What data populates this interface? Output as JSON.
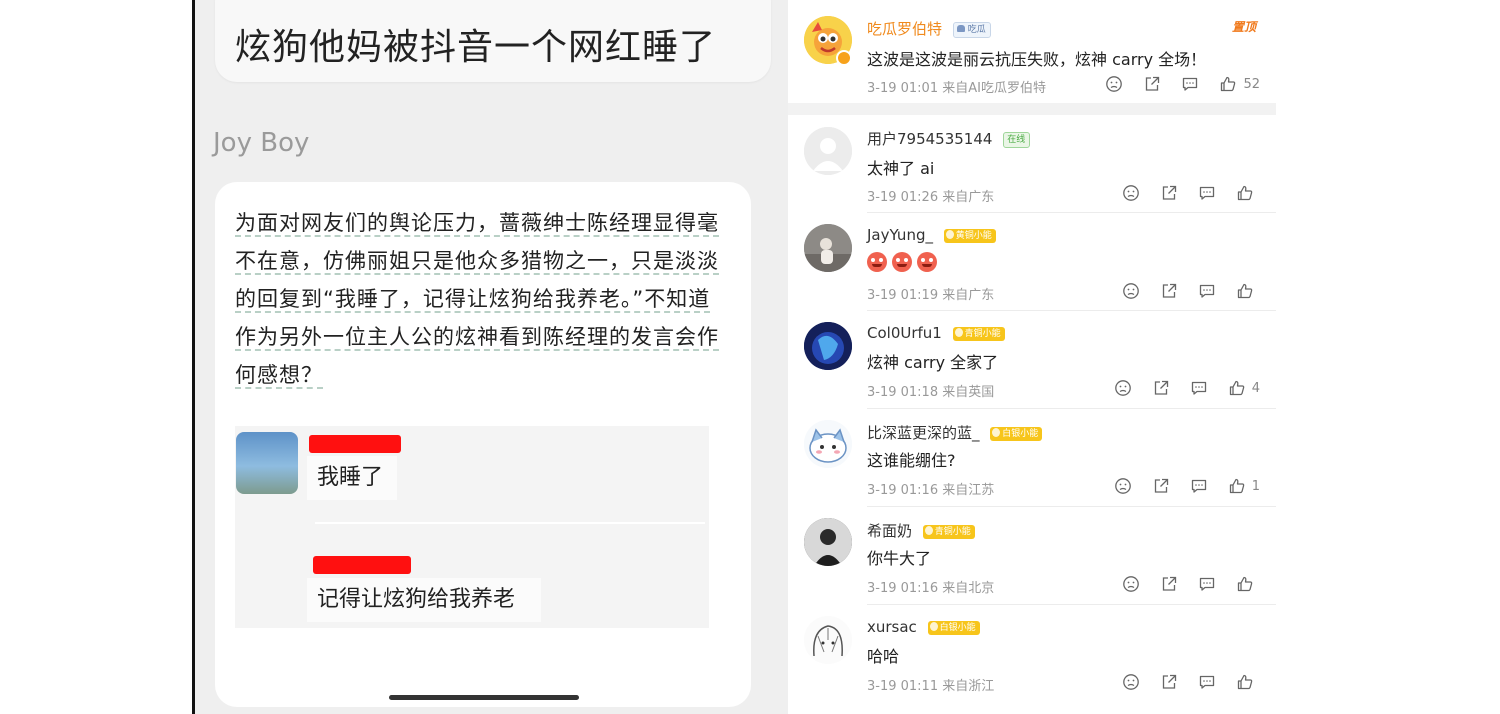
{
  "left": {
    "title": "炫狗他妈被抖音一个网红睡了",
    "sender": "Joy Boy",
    "post_lines": [
      "为面对网友们的舆论压力，蔷薇绅士陈经理显得毫",
      "不在意，仿佛丽姐只是他众多猎物之一，只是淡淡",
      "的回复到“我睡了，记得让炫狗给我养老。”不知道",
      "作为另外一位主人公的炫神看到陈经理的发言会作",
      "何感想？"
    ],
    "chat_message_1": "我睡了",
    "chat_message_2": "记得让炫狗给我养老"
  },
  "right": {
    "pinned": {
      "user": "吃瓜罗伯特",
      "badge": "吃瓜",
      "tag": "置顶",
      "text": "这波是这波是丽云抗压失败，炫神 carry 全场！",
      "meta": "3-19 01:01  来自AI吃瓜罗伯特",
      "likes": "52"
    },
    "comments": [
      {
        "user": "用户7954535144",
        "badge": "在线",
        "text": "太神了 ai",
        "meta": "3-19 01:26  来自广东",
        "likes": ""
      },
      {
        "user": "JayYung_",
        "badge": "黄铜小能",
        "text": "",
        "meta": "3-19 01:19  来自广东",
        "likes": ""
      },
      {
        "user": "Col0Urfu1",
        "badge": "青铜小能",
        "text": "炫神 carry 全家了",
        "meta": "3-19 01:18  来自英国",
        "likes": "4"
      },
      {
        "user": "比深蓝更深的蓝_",
        "badge": "白银小能",
        "text": "这谁能绷住?",
        "meta": "3-19 01:16  来自江苏",
        "likes": "1"
      },
      {
        "user": "希面奶",
        "badge": "青铜小能",
        "text": "你牛大了",
        "meta": "3-19 01:16  来自北京",
        "likes": ""
      },
      {
        "user": "xursac",
        "badge": "白银小能",
        "text": "哈哈",
        "meta": "3-19 01:11  来自浙江",
        "likes": ""
      }
    ]
  }
}
